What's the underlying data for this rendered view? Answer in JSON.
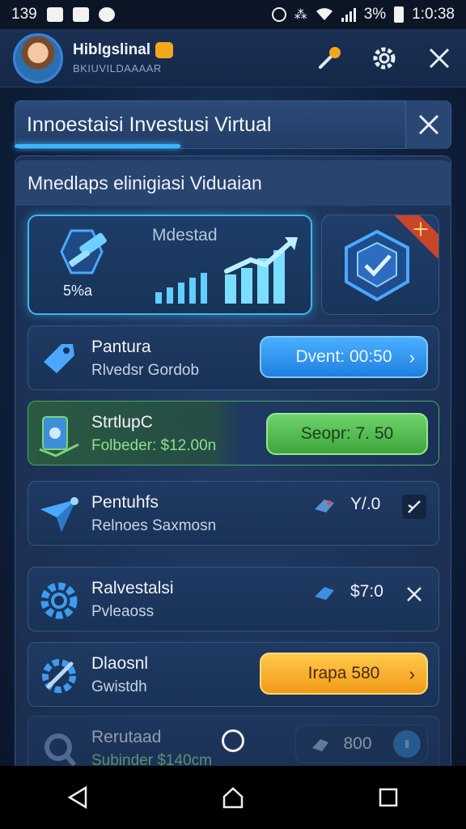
{
  "status_bar": {
    "time_left": "139",
    "battery_pct": "3%",
    "clock": "1:0:38"
  },
  "player": {
    "name": "Hiblgslinal",
    "subtitle": "BKIUVILDAAAAR"
  },
  "panel": {
    "title": "Innoestaisi Investusi Virtual",
    "subtitle": "Mnedlaps elinigiasi Viduaian"
  },
  "hero": {
    "label": "Mdestad",
    "percent": "5%a"
  },
  "rows": [
    {
      "name": "Pantura",
      "desc": "Rlvedsr Gordob",
      "action": "Dvent: 00:50",
      "color": "#1f7fe0"
    },
    {
      "name": "StrtlupC",
      "desc": "Folbeder: $12.00n",
      "action": "Seopr: 7. 50",
      "color": "#3ea53d"
    },
    {
      "name": "Pentuhfs",
      "desc": "Relnoes Saxmosn",
      "price": "Y/.0"
    },
    {
      "name": "Ralvestalsi",
      "desc": "Pvleaoss",
      "price": "$7:0"
    },
    {
      "name": "Dlaosnl",
      "desc": "Gwistdh",
      "action": "Irapa 580",
      "color": "#f29b18"
    },
    {
      "name": "Rerutaad",
      "desc": "Subinder $140cm",
      "price": "800"
    }
  ]
}
